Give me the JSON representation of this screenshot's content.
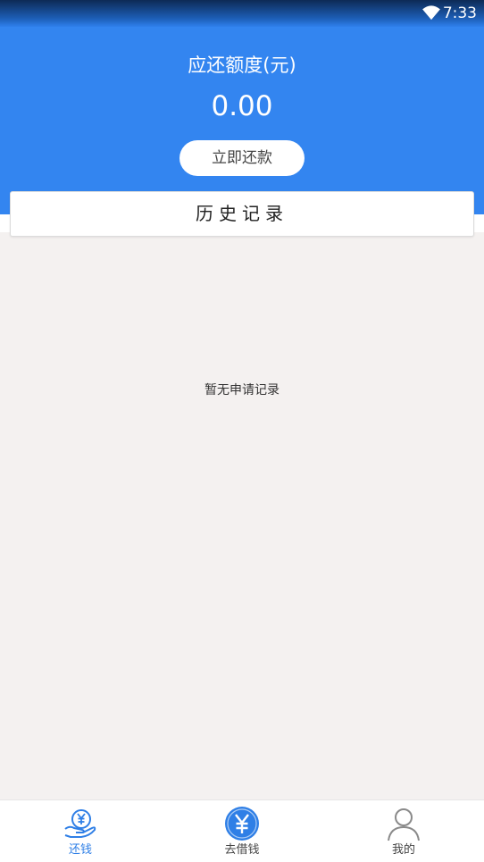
{
  "status_bar": {
    "time": "7:33",
    "wifi_icon": "wifi-icon"
  },
  "header": {
    "amount_label": "应还额度(元)",
    "amount_value": "0.00",
    "repay_button_label": "立即还款",
    "background_color": "#3385f0"
  },
  "history": {
    "title": "历史记录",
    "empty_text": "暂无申请记录"
  },
  "tabbar": {
    "items": [
      {
        "label": "还钱",
        "icon": "repay-hand-icon",
        "active": true
      },
      {
        "label": "去借钱",
        "icon": "yuan-coin-icon",
        "active": false
      },
      {
        "label": "我的",
        "icon": "user-profile-icon",
        "active": false
      }
    ],
    "active_color": "#2f7fe6"
  }
}
